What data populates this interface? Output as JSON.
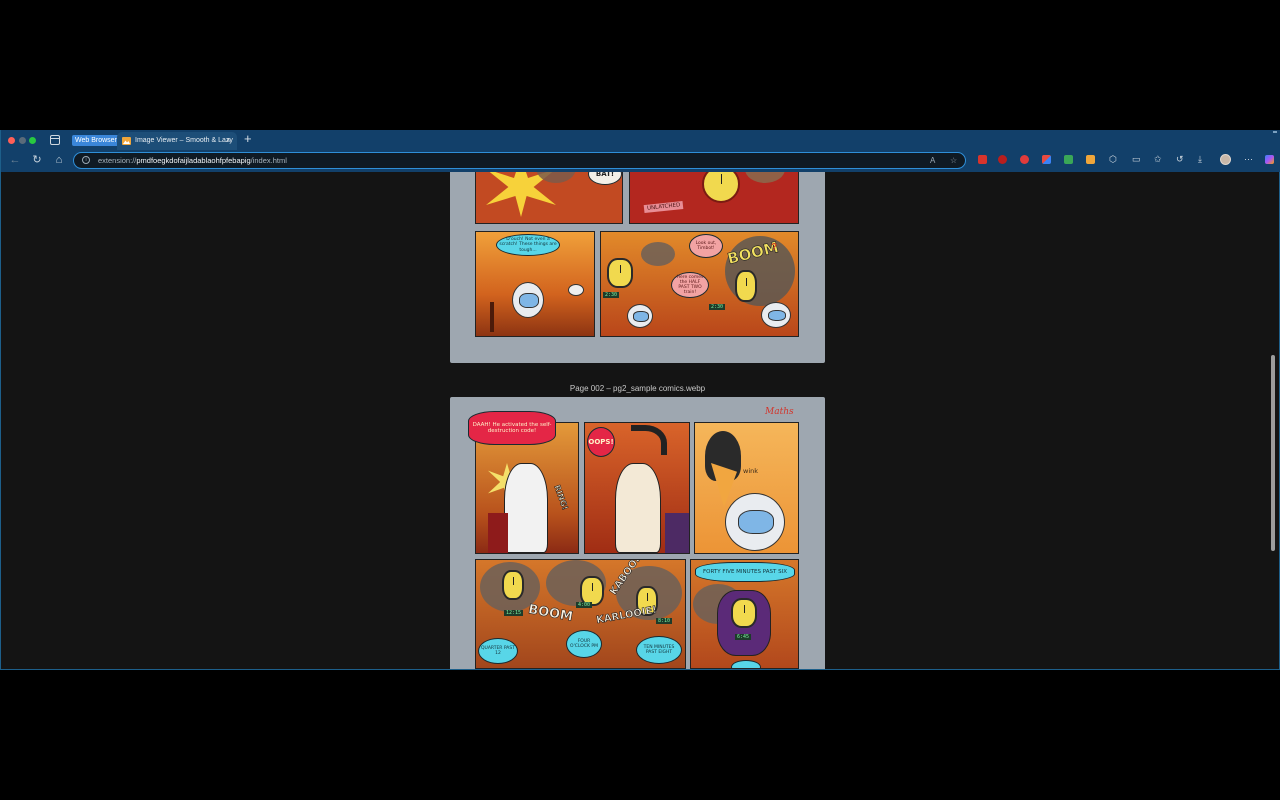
{
  "browser": {
    "profile_label": "Web Browser",
    "tab": {
      "title": "Image Viewer – Smooth & Lazy",
      "close": "×"
    },
    "new_tab": "+",
    "address": {
      "scheme": "extension://",
      "host": "pmdfoegkdofaijladablaohfpfebapig",
      "path": "/index.html"
    },
    "nav": {
      "back": "←",
      "reload": "↻",
      "home": "⌂"
    },
    "toolbar_icons": [
      "read-aloud-icon",
      "favorite-star-icon",
      "split-screen-icon",
      "favorites-icon",
      "history-icon",
      "downloads-icon",
      "more-icon"
    ]
  },
  "viewer": {
    "page2_caption": "Page 002 – pg2_sample comics.webp",
    "page1": {
      "sfx_bat": "BAT!",
      "unlatched": "UNLATCHED",
      "bubble_ouch": "D'ouch! Not even a scratch! These things are tough...",
      "bubble_lookout": "Look out, Timbot!",
      "bubble_halfpast": "Here comes the HALF PAST TWO train!",
      "sfx_boom": "BOOM",
      "readout": "2:30",
      "question": "?"
    },
    "page2": {
      "title_corner": "Maths",
      "bubble_daah": "DAAH! He activated the self-destruction code!",
      "sfx_ring": "RING!",
      "sfx_oops": "OOPS!",
      "sfx_wink": "wink",
      "sfx_kaboom": "KABOOM",
      "sfx_boom": "BOOM",
      "sfx_karloo": "KARLOOIE!",
      "bubble_quarter": "QUARTER PAST 12",
      "bubble_four": "FOUR O'CLOCK PM",
      "bubble_ten": "TEN MINUTES PAST EIGHT",
      "bubble_fortyfive": "FORTY FIVE MINUTES PAST SIX",
      "readout_a": "12:15",
      "readout_b": "4:00",
      "readout_c": "8:10",
      "readout_d": "6:45"
    }
  }
}
